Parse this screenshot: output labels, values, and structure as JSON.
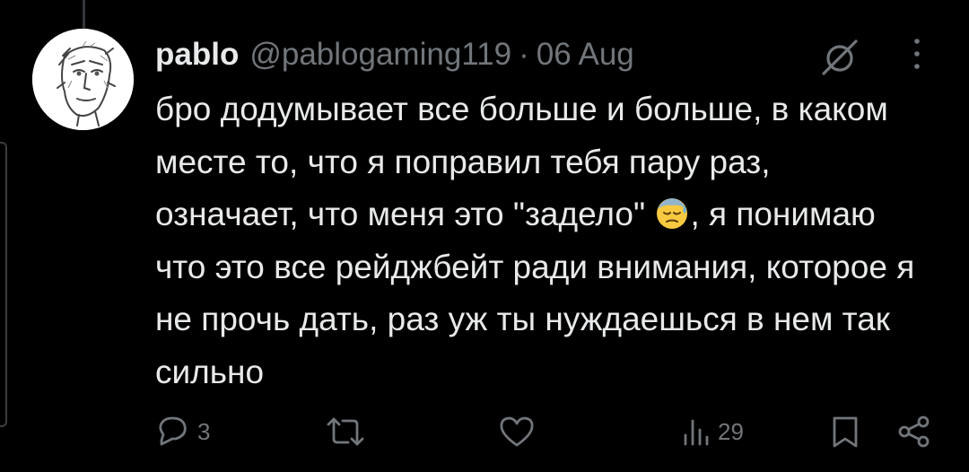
{
  "tweet": {
    "author_name": "pablo",
    "handle": "@pablogaming119",
    "separator": "·",
    "date": "06 Aug",
    "text_before_emoji": "бро додумывает все больше и больше, в каком месте то, что я поправил тебя пару раз, означает, что меня это \"задело\"",
    "emoji": "downcast-face-with-sweat",
    "text_after_emoji": ", я понимаю что это все рейджбейт ради внимания, которое я не прочь дать, раз уж ты нуждаешься в нем так сильно"
  },
  "actions": {
    "reply_count": "3",
    "repost_count": "",
    "like_count": "",
    "views_count": "29"
  },
  "icons": {
    "reply": "speech-bubble-icon",
    "repost": "repost-arrows-icon",
    "like": "heart-icon",
    "views": "bar-chart-icon",
    "bookmark": "bookmark-icon",
    "share": "share-nodes-icon",
    "grok": "slashed-circle-icon",
    "more": "vertical-dots-icon"
  },
  "colors": {
    "background": "#000000",
    "primary_text": "#e7e9ea",
    "secondary_text": "#71767b",
    "thread_line": "#333639"
  }
}
